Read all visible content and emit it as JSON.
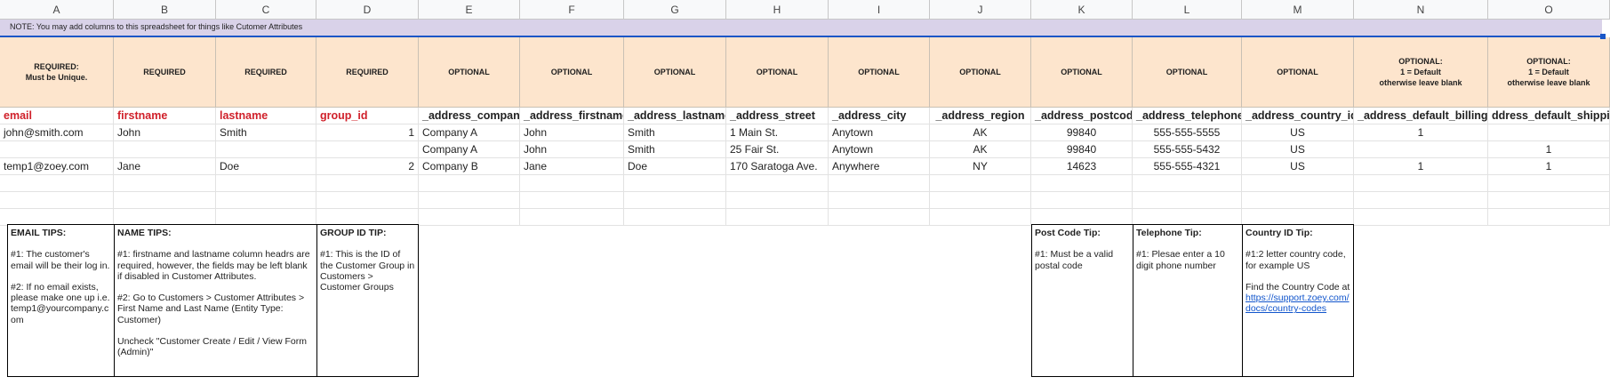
{
  "columns": [
    "A",
    "B",
    "C",
    "D",
    "E",
    "F",
    "G",
    "H",
    "I",
    "J",
    "K",
    "L",
    "M",
    "N",
    "O"
  ],
  "note": "NOTE: You may add columns to this spreadsheet for things like Cutomer Attributes",
  "requirement_row": [
    "REQUIRED:\nMust be Unique.",
    "REQUIRED",
    "REQUIRED",
    "REQUIRED",
    "OPTIONAL",
    "OPTIONAL",
    "OPTIONAL",
    "OPTIONAL",
    "OPTIONAL",
    "OPTIONAL",
    "OPTIONAL",
    "OPTIONAL",
    "OPTIONAL",
    "OPTIONAL:\n1 = Default\notherwise leave blank",
    "OPTIONAL:\n1 = Default\notherwise leave blank"
  ],
  "field_headers": [
    "email",
    "firstname",
    "lastname",
    "group_id",
    "_address_company",
    "_address_firstname",
    "_address_lastname",
    "_address_street",
    "_address_city",
    "_address_region",
    "_address_postcode",
    "_address_telephone",
    "_address_country_id",
    "_address_default_billing_",
    "ddress_default_shipping_"
  ],
  "rows": [
    [
      "john@smith.com",
      "John",
      "Smith",
      "1",
      "Company A",
      "John",
      "Smith",
      "1 Main St.",
      "Anytown",
      "AK",
      "99840",
      "555-555-5555",
      "US",
      "1",
      ""
    ],
    [
      "",
      "",
      "",
      "",
      "Company A",
      "John",
      "Smith",
      "25 Fair St.",
      "Anytown",
      "AK",
      "99840",
      "555-555-5432",
      "US",
      "",
      "1"
    ],
    [
      "temp1@zoey.com",
      "Jane",
      "Doe",
      "2",
      "Company B",
      "Jane",
      "Doe",
      "170 Saratoga Ave.",
      "Anywhere",
      "NY",
      "14623",
      "555-555-4321",
      "US",
      "1",
      "1"
    ]
  ],
  "tips": {
    "email": {
      "title": "EMAIL TIPS:",
      "p1": "#1: The customer's email will be their log in.",
      "p2": "#2: If no email exists, please make one up i.e. temp1@yourcompany.c om"
    },
    "name": {
      "title": "NAME TIPS:",
      "p1": "#1: firstname and lastname column headrs are required, however, the fields may be left blank if disabled in Customer Attributes.",
      "p2": "#2: Go to Customers > Customer Attributes > First Name and Last Name (Entity Type: Customer)",
      "p3": "Uncheck \"Customer Create / Edit / View Form (Admin)\""
    },
    "group": {
      "title": "GROUP ID TIP:",
      "p1": "#1: This is the ID of the Customer Group in Customers > Customer Groups"
    },
    "postcode": {
      "title": "Post Code Tip:",
      "p1": "#1: Must be a valid postal code"
    },
    "telephone": {
      "title": "Telephone Tip:",
      "p1": "#1: Plesae enter a 10 digit phone number"
    },
    "country": {
      "title": "Country ID Tip:",
      "p1": "#1:2 letter country code, for example US",
      "p2": "Find the Country Code at",
      "link": "https://support.zoey.com/docs/country-codes"
    }
  },
  "colors": {
    "note_bg": "#d9d2e9",
    "req_bg": "#fde5cd",
    "required_text": "#d0202a",
    "selection": "#1a56c7",
    "link": "#1155cc"
  }
}
